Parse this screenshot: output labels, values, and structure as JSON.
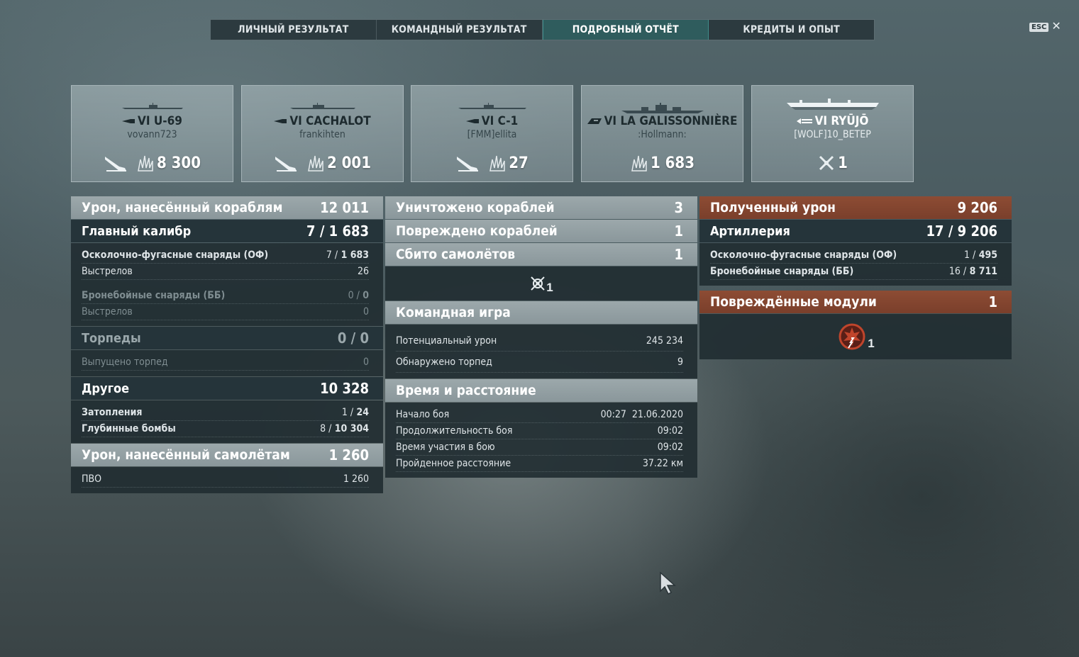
{
  "tabs": [
    {
      "label": "ЛИЧНЫЙ РЕЗУЛЬТАТ",
      "active": false
    },
    {
      "label": "КОМАНДНЫЙ РЕЗУЛЬТАТ",
      "active": false
    },
    {
      "label": "ПОДРОБНЫЙ ОТЧЁТ",
      "active": true
    },
    {
      "label": "КРЕДИТЫ И ОПЫТ",
      "active": false
    }
  ],
  "esc": {
    "key": "ESC"
  },
  "ships": [
    {
      "name": "VI U-69",
      "player": "vovann723",
      "value": "8 300",
      "class_icon": "submarine-icon",
      "kind": "sub"
    },
    {
      "name": "VI CACHALOT",
      "player": "frankihten",
      "value": "2 001",
      "class_icon": "submarine-icon",
      "kind": "sub"
    },
    {
      "name": "VI C-1",
      "player": "[FMM]ellita",
      "value": "27",
      "class_icon": "submarine-icon",
      "kind": "sub"
    },
    {
      "name": "VI LA GALISSONNIÈRE",
      "player": ":Hollmann:",
      "value": "1 683",
      "class_icon": "cruiser-icon",
      "kind": "cruiser"
    },
    {
      "name": "VI RYŪJŌ",
      "player": "[WOLF]10_ВЕТЕР",
      "value": "1",
      "class_icon": "carrier-icon",
      "kind": "carrier"
    }
  ],
  "left": {
    "dealt": {
      "label": "Урон, нанесённый кораблям",
      "value": "12 011"
    },
    "main": {
      "label": "Главный калибр",
      "value": "7 / 1 683"
    },
    "he": {
      "label": "Осколочно-фугасные снаряды (ОФ)",
      "hits": "7 /",
      "dmg": "1 683"
    },
    "he_shots": {
      "label": "Выстрелов",
      "value": "26"
    },
    "ap": {
      "label": "Бронебойные снаряды (ББ)",
      "hits": "0 /",
      "dmg": "0"
    },
    "ap_shots": {
      "label": "Выстрелов",
      "value": "0"
    },
    "torp": {
      "label": "Торпеды",
      "value": "0 / 0"
    },
    "torp_fired": {
      "label": "Выпущено торпед",
      "value": "0"
    },
    "other": {
      "label": "Другое",
      "value": "10 328"
    },
    "flood": {
      "label": "Затопления",
      "hits": "1 /",
      "dmg": "24"
    },
    "depth": {
      "label": "Глубинные бомбы",
      "hits": "8 /",
      "dmg": "10 304"
    },
    "planes": {
      "label": "Урон, нанесённый самолётам",
      "value": "1 260"
    },
    "aa": {
      "label": "ПВО",
      "value": "1 260"
    }
  },
  "mid": {
    "destroyed": {
      "label": "Уничтожено кораблей",
      "value": "3"
    },
    "damaged": {
      "label": "Повреждено кораблей",
      "value": "1"
    },
    "shot": {
      "label": "Сбито самолётов",
      "value": "1"
    },
    "shot_icon_count": "1",
    "team": {
      "label": "Командная игра"
    },
    "potential": {
      "label": "Потенциальный урон",
      "value": "245 234"
    },
    "spotted": {
      "label": "Обнаружено торпед",
      "value": "9"
    },
    "time": {
      "label": "Время и расстояние"
    },
    "start": {
      "label": "Начало боя",
      "value": "00:27  21.06.2020"
    },
    "duration": {
      "label": "Продолжительность боя",
      "value": "09:02"
    },
    "participation": {
      "label": "Время участия в бою",
      "value": "09:02"
    },
    "distance": {
      "label": "Пройденное расстояние",
      "value": "37.22 км"
    }
  },
  "right": {
    "received": {
      "label": "Полученный урон",
      "value": "9 206"
    },
    "artillery": {
      "label": "Артиллерия",
      "value": "17 / 9 206"
    },
    "he": {
      "label": "Осколочно-фугасные снаряды (ОФ)",
      "hits": "1 /",
      "dmg": "495"
    },
    "ap": {
      "label": "Бронебойные снаряды (ББ)",
      "hits": "16 /",
      "dmg": "8 711"
    },
    "modules": {
      "label": "Повреждённые модули",
      "value": "1"
    },
    "module_icon_count": "1"
  },
  "colors": {
    "accent_tab": "#2f5c5d",
    "red_header": "#8d4c34",
    "panel": "#25343a"
  }
}
